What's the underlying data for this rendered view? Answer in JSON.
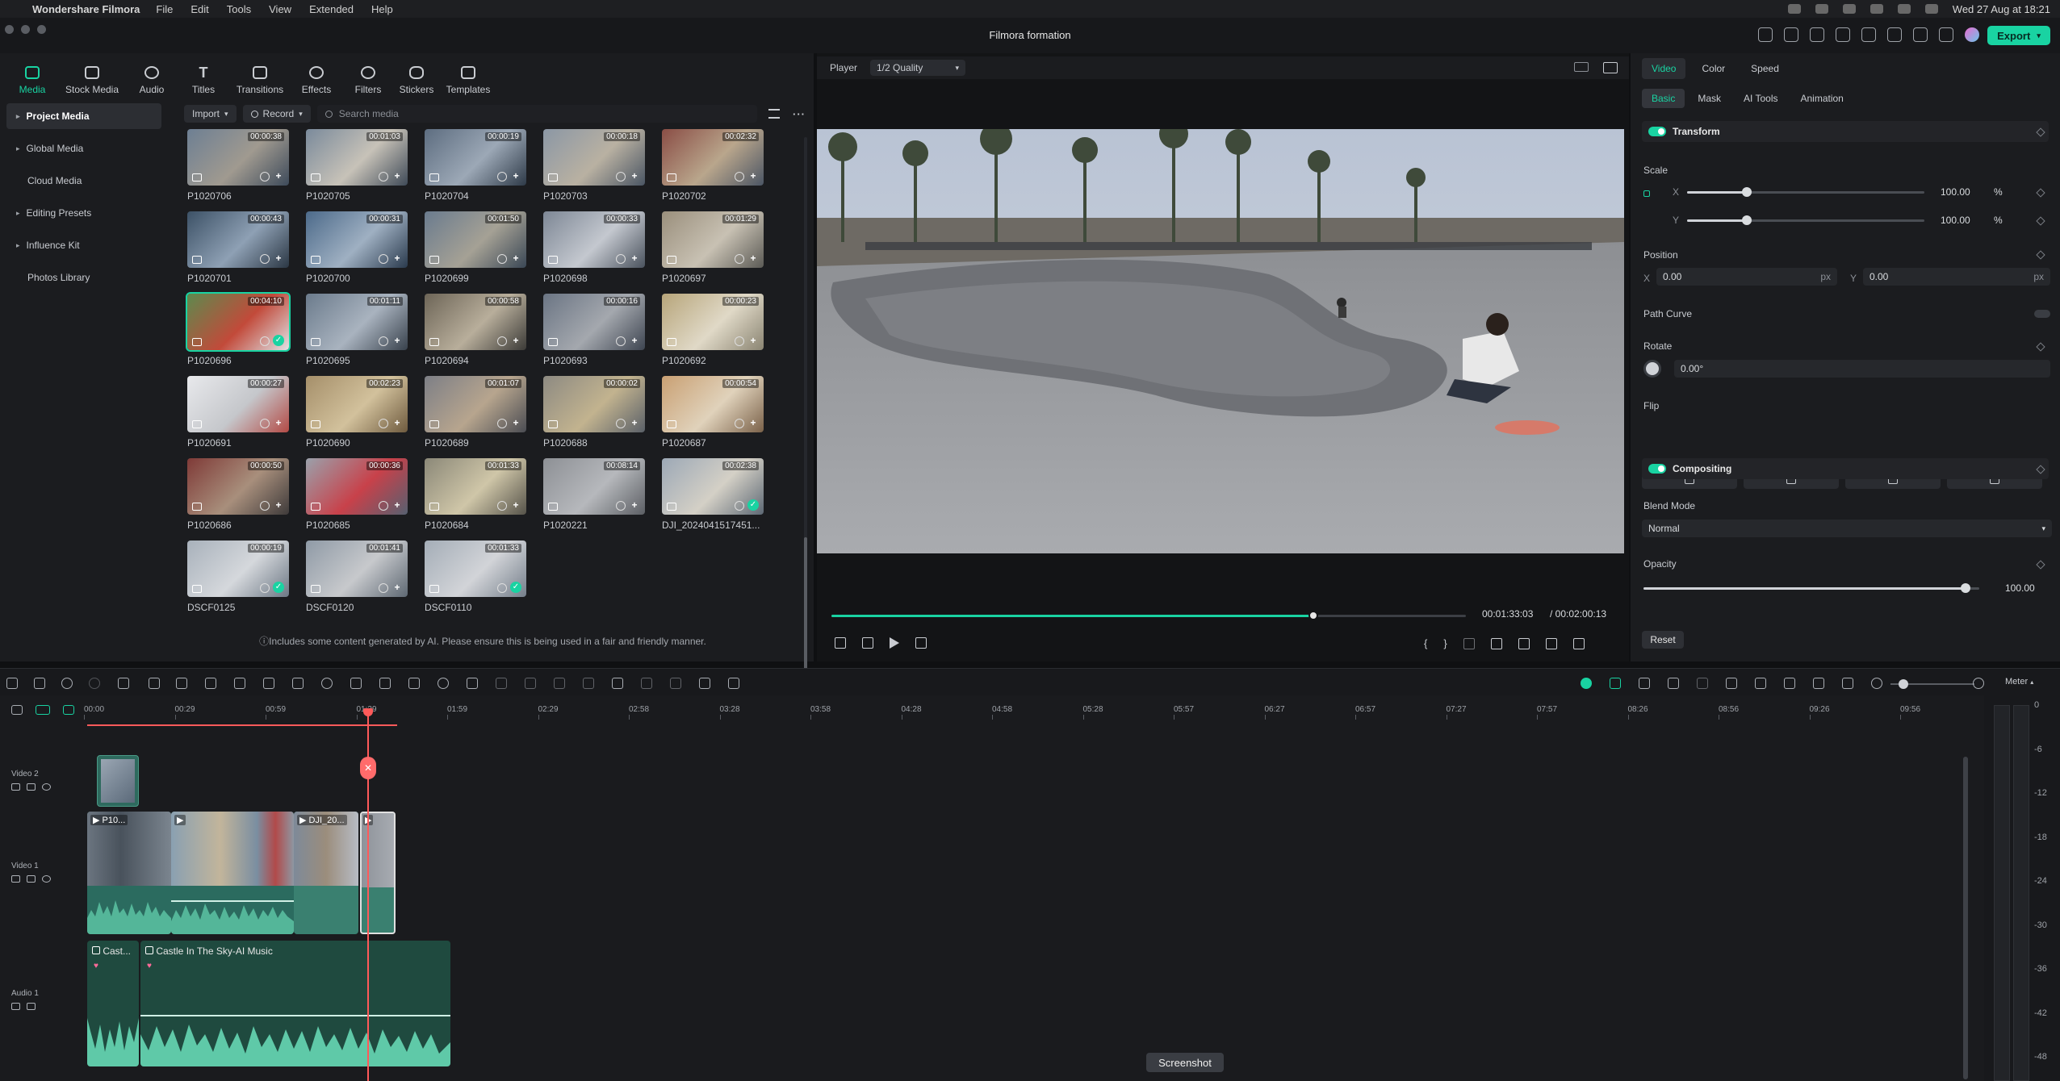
{
  "menubar": {
    "app_name": "Wondershare Filmora",
    "items": [
      "File",
      "Edit",
      "Tools",
      "View",
      "Extended",
      "Help"
    ],
    "clock": "Wed 27 Aug at 18:21"
  },
  "window": {
    "title": "Filmora formation",
    "export_label": "Export"
  },
  "media_tabs": [
    "Media",
    "Stock Media",
    "Audio",
    "Titles",
    "Transitions",
    "Effects",
    "Filters",
    "Stickers",
    "Templates"
  ],
  "sidebar": {
    "items": [
      {
        "label": "Project Media",
        "active": true
      },
      {
        "label": "Global Media"
      },
      {
        "label": "Cloud Media"
      },
      {
        "label": "Editing Presets"
      },
      {
        "label": "Influence Kit"
      },
      {
        "label": "Photos Library"
      }
    ]
  },
  "media_toolbar": {
    "import": "Import",
    "record": "Record",
    "search_placeholder": "Search media"
  },
  "media": [
    {
      "name": "P1020706",
      "duration": "00:00:38",
      "state": "add"
    },
    {
      "name": "P1020705",
      "duration": "00:01:03",
      "state": "add"
    },
    {
      "name": "P1020704",
      "duration": "00:00:19",
      "state": "add"
    },
    {
      "name": "P1020703",
      "duration": "00:00:18",
      "state": "add"
    },
    {
      "name": "P1020702",
      "duration": "00:02:32",
      "state": "add"
    },
    {
      "name": "P1020701",
      "duration": "00:00:43",
      "state": "add"
    },
    {
      "name": "P1020700",
      "duration": "00:00:31",
      "state": "add"
    },
    {
      "name": "P1020699",
      "duration": "00:01:50",
      "state": "add"
    },
    {
      "name": "P1020698",
      "duration": "00:00:33",
      "state": "add"
    },
    {
      "name": "P1020697",
      "duration": "00:01:29",
      "state": "add"
    },
    {
      "name": "P1020696",
      "duration": "00:04:10",
      "state": "used",
      "selected": true
    },
    {
      "name": "P1020695",
      "duration": "00:01:11",
      "state": "add"
    },
    {
      "name": "P1020694",
      "duration": "00:00:58",
      "state": "add"
    },
    {
      "name": "P1020693",
      "duration": "00:00:16",
      "state": "add"
    },
    {
      "name": "P1020692",
      "duration": "00:00:23",
      "state": "add"
    },
    {
      "name": "P1020691",
      "duration": "00:00:27",
      "state": "add"
    },
    {
      "name": "P1020690",
      "duration": "00:02:23",
      "state": "add"
    },
    {
      "name": "P1020689",
      "duration": "00:01:07",
      "state": "add"
    },
    {
      "name": "P1020688",
      "duration": "00:00:02",
      "state": "add"
    },
    {
      "name": "P1020687",
      "duration": "00:00:54",
      "state": "add"
    },
    {
      "name": "P1020686",
      "duration": "00:00:50",
      "state": "add"
    },
    {
      "name": "P1020685",
      "duration": "00:00:36",
      "state": "add"
    },
    {
      "name": "P1020684",
      "duration": "00:01:33",
      "state": "add"
    },
    {
      "name": "P1020221",
      "duration": "00:08:14",
      "state": "add"
    },
    {
      "name": "DJI_2024041517451...",
      "duration": "00:02:38",
      "state": "used"
    },
    {
      "name": "DSCF0125",
      "duration": "00:00:19",
      "state": "used"
    },
    {
      "name": "DSCF0120",
      "duration": "00:01:41",
      "state": "add"
    },
    {
      "name": "DSCF0110",
      "duration": "00:01:33",
      "state": "used"
    }
  ],
  "ai_note": "Includes some content generated by AI. Please ensure this is being used in a fair and friendly manner.",
  "player": {
    "label": "Player",
    "quality": "1/2 Quality",
    "current_time": "00:01:33:03",
    "total_time": "/ 00:02:00:13",
    "progress": 0.76
  },
  "inspector": {
    "tabs": [
      "Video",
      "Color",
      "Speed"
    ],
    "sub_tabs": [
      "Basic",
      "Mask",
      "AI Tools",
      "Animation"
    ],
    "transform_label": "Transform",
    "scale_label": "Scale",
    "scale_x_axis": "X",
    "scale_y_axis": "Y",
    "scale_x": "100.00",
    "scale_y": "100.00",
    "scale_unit": "%",
    "position_label": "Position",
    "pos_x_axis": "X",
    "pos_y_axis": "Y",
    "pos_x": "0.00",
    "pos_y": "0.00",
    "pos_unit": "px",
    "path_curve": "Path Curve",
    "rotate_label": "Rotate",
    "rotate_value": "0.00°",
    "flip_label": "Flip",
    "compositing_label": "Compositing",
    "blend_label": "Blend Mode",
    "blend_value": "Normal",
    "opacity_label": "Opacity",
    "opacity_value": "100.00",
    "reset": "Reset"
  },
  "timeline": {
    "ruler": [
      "00:00",
      "00:29",
      "00:59",
      "01:29",
      "01:59",
      "02:29",
      "02:58",
      "03:28",
      "03:58",
      "04:28",
      "04:58",
      "05:28",
      "05:57",
      "06:27",
      "06:57",
      "07:27",
      "07:57",
      "08:26",
      "08:56",
      "09:26",
      "09:56"
    ],
    "tracks": [
      {
        "name": "Video 2"
      },
      {
        "name": "Video 1"
      },
      {
        "name": "Audio 1"
      }
    ],
    "clips_video1": [
      "P10...",
      "",
      "DJI_20...",
      ""
    ],
    "audio_clips": [
      "Cast...",
      "Castle In The Sky-AI Music"
    ],
    "meter_label": "Meter",
    "meter_scale": [
      "0",
      "-6",
      "-12",
      "-18",
      "-24",
      "-30",
      "-36",
      "-42",
      "-48"
    ]
  },
  "tooltip": "Screenshot",
  "colors": {
    "accent": "#19d3a2",
    "playhead": "#ff5a5a",
    "clip_video": "#3a7f70",
    "clip_audio": "#1f4a3f"
  }
}
